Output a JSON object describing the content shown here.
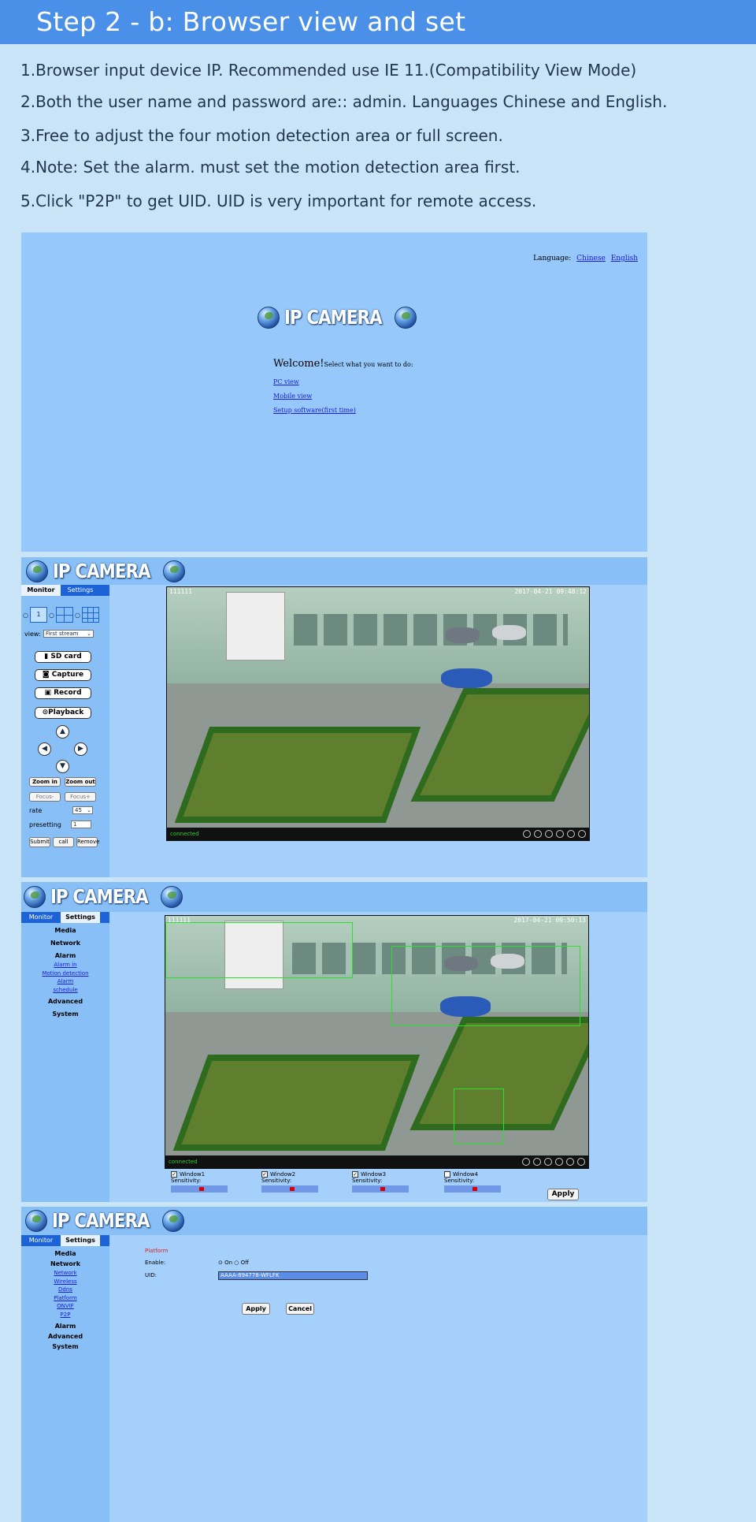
{
  "header": {
    "title": "Step 2 - b:  Browser view and set"
  },
  "steps": [
    "1.Browser input device IP. Recommended use IE 11.(Compatibility View Mode)",
    "2.Both the user name and password are:: admin. Languages Chinese and English.",
    "3.Free to adjust the four motion detection area or full screen.",
    "4.Note: Set the alarm. must set the motion detection area first.",
    "5.Click \"P2P\" to get UID. UID is very important for remote access."
  ],
  "login": {
    "language_label": "Language:",
    "lang_chinese": "Chinese",
    "lang_english": "English",
    "logo": "IP CAMERA",
    "welcome": "Welcome!",
    "welcome_sub": "Select what you want to do:",
    "links": [
      "PC view",
      "Mobile view",
      "Setup software(first time)"
    ]
  },
  "monitor": {
    "logo": "IP CAMERA",
    "tab_monitor": "Monitor",
    "tab_settings": "Settings",
    "split_value": "1",
    "view_label": "view:",
    "view_value": "First stream",
    "buttons": [
      "SD card",
      "Capture",
      "Record",
      "Playback"
    ],
    "zoom_in": "Zoom in",
    "zoom_out": "Zoom out",
    "focus_minus": "Focus-",
    "focus_plus": "Focus+",
    "rate_label": "rate",
    "rate_value": "45",
    "presetting_label": "presetting",
    "presetting_value": "1",
    "submit": "Submit",
    "call": "call",
    "remove": "Remove",
    "video_id": "111111",
    "timestamp": "2017-04-21 09:48:12",
    "status": "connected"
  },
  "motion": {
    "logo": "IP CAMERA",
    "tab_monitor": "Monitor",
    "tab_settings": "Settings",
    "menu": {
      "media": "Media",
      "network": "Network",
      "alarm": "Alarm",
      "alarm_in": "Alarm in",
      "motion_detection": "Motion detection",
      "alarm_schedule_1": "Alarm",
      "alarm_schedule_2": "schedule",
      "advanced": "Advanced",
      "system": "System"
    },
    "video_id": "111111",
    "timestamp": "2017-04-21 09:50:13",
    "status": "connected",
    "windows": [
      "Window1",
      "Window2",
      "Window3",
      "Window4"
    ],
    "sensitivity": "Sensitivity:",
    "apply": "Apply"
  },
  "p2p": {
    "logo": "IP CAMERA",
    "tab_monitor": "Monitor",
    "tab_settings": "Settings",
    "menu": {
      "media": "Media",
      "network": "Network",
      "sub": [
        "Network",
        "Wireless",
        "Ddns",
        "Platform",
        "ONVIF",
        "P2P"
      ],
      "alarm": "Alarm",
      "advanced": "Advanced",
      "system": "System"
    },
    "section": "Platform",
    "enable_label": "Enable:",
    "on": "On",
    "off": "Off",
    "uid_label": "UID:",
    "uid_value": "AAAA-894778-WFLFK",
    "apply": "Apply",
    "cancel": "Cancel"
  },
  "colors": {
    "banner": "#4a90e8",
    "page_bg": "#c9e3f7",
    "panel_bg": "#a5d0fb",
    "tab_blue": "#1b63d6",
    "zone_green": "#2be02b"
  }
}
